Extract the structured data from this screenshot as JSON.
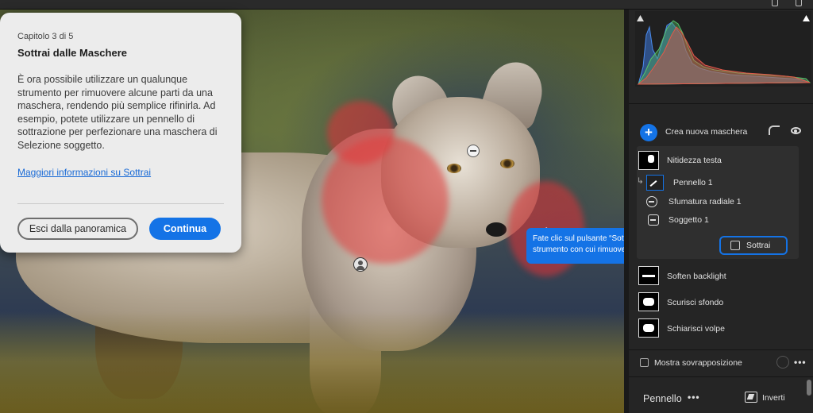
{
  "tour": {
    "chapter": "Capitolo 3 di 5",
    "title": "Sottrai dalle Maschere",
    "body": "È ora possibile utilizzare un qualunque strumento per rimuovere alcune parti da una maschera, rendendo più semplice rifinirla. Ad esempio, potete utilizzare un pennello di sottrazione per perfezionare una maschera di Selezione soggetto.",
    "link": "Maggiori informazioni su Sottrai",
    "exit_label": "Esci dalla panoramica",
    "continue_label": "Continua"
  },
  "tooltip": {
    "text": "Fate clic sul pulsante “Sottrai” per scegliere lo strumento con cui rimuovere la maschera"
  },
  "panel": {
    "create_mask": "Crea nuova maschera",
    "active_mask": {
      "name": "Nitidezza testa",
      "components": [
        {
          "label": "Pennello 1",
          "icon": "brush-subtract-icon"
        },
        {
          "label": "Sfumatura radiale 1",
          "icon": "radial-gradient-icon"
        },
        {
          "label": "Soggetto 1",
          "icon": "subject-icon"
        }
      ],
      "subtract_button": "Sottrai"
    },
    "masks": [
      {
        "label": "Soften backlight"
      },
      {
        "label": "Scurisci sfondo"
      },
      {
        "label": "Schiarisci volpe"
      }
    ],
    "overlay_label": "Mostra sovrapposizione",
    "tool_label": "Pennello",
    "invert_label": "Inverti"
  },
  "colors": {
    "accent": "#1473e6",
    "mask_overlay": "#e13237"
  }
}
